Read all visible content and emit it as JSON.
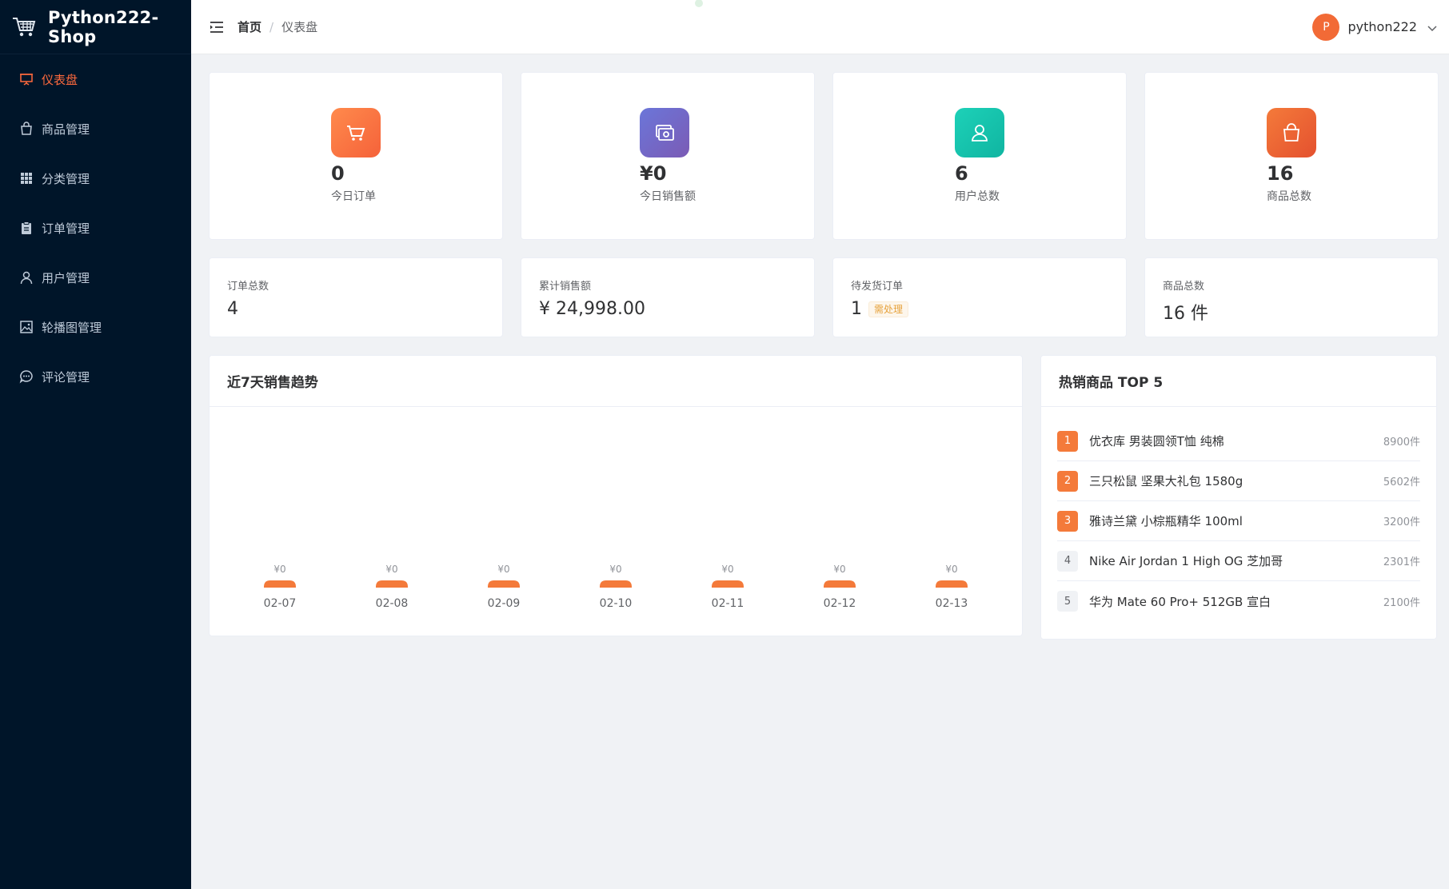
{
  "app": {
    "title": "Python222-Shop"
  },
  "sidebar": {
    "items": [
      {
        "label": "仪表盘",
        "icon": "presentation-icon",
        "active": true
      },
      {
        "label": "商品管理",
        "icon": "bag-icon",
        "active": false
      },
      {
        "label": "分类管理",
        "icon": "grid-icon",
        "active": false
      },
      {
        "label": "订单管理",
        "icon": "clipboard-icon",
        "active": false
      },
      {
        "label": "用户管理",
        "icon": "user-icon",
        "active": false
      },
      {
        "label": "轮播图管理",
        "icon": "picture-icon",
        "active": false
      },
      {
        "label": "评论管理",
        "icon": "chat-icon",
        "active": false
      }
    ]
  },
  "header": {
    "breadcrumb": {
      "home": "首页",
      "separator": "/",
      "current": "仪表盘"
    },
    "user": {
      "avatar_letter": "P",
      "name": "python222"
    }
  },
  "stats": [
    {
      "value": "0",
      "label": "今日订单",
      "icon": "cart-icon",
      "color": "#f5623a"
    },
    {
      "value": "¥0",
      "label": "今日销售额",
      "icon": "money-icon",
      "color": "#6b76d9"
    },
    {
      "value": "6",
      "label": "用户总数",
      "icon": "user-icon",
      "color": "#10b5a1"
    },
    {
      "value": "16",
      "label": "商品总数",
      "icon": "bag-icon",
      "color": "#e4512f"
    }
  ],
  "summary": [
    {
      "label": "订单总数",
      "value": "4"
    },
    {
      "label": "累计销售额",
      "value": "¥ 24,998.00"
    },
    {
      "label": "待发货订单",
      "value": "1",
      "tag": "需处理"
    },
    {
      "label": "商品总数",
      "value": "16 件"
    }
  ],
  "sales_chart": {
    "title": "近7天销售趋势",
    "bar_color": "#f47a3a"
  },
  "chart_data": {
    "type": "bar",
    "title": "近7天销售趋势",
    "categories": [
      "02-07",
      "02-08",
      "02-09",
      "02-10",
      "02-11",
      "02-12",
      "02-13"
    ],
    "values": [
      0,
      0,
      0,
      0,
      0,
      0,
      0
    ],
    "value_labels": [
      "¥0",
      "¥0",
      "¥0",
      "¥0",
      "¥0",
      "¥0",
      "¥0"
    ],
    "xlabel": "",
    "ylabel": ""
  },
  "top_products": {
    "title": "热销商品 TOP 5",
    "items": [
      {
        "rank": "1",
        "name": "优衣库 男装圆领T恤 纯棉",
        "sales": "8900件",
        "hot": true
      },
      {
        "rank": "2",
        "name": "三只松鼠 坚果大礼包 1580g",
        "sales": "5602件",
        "hot": true
      },
      {
        "rank": "3",
        "name": "雅诗兰黛 小棕瓶精华 100ml",
        "sales": "3200件",
        "hot": true
      },
      {
        "rank": "4",
        "name": "Nike Air Jordan 1 High OG 芝加哥",
        "sales": "2301件",
        "hot": false
      },
      {
        "rank": "5",
        "name": "华为 Mate 60 Pro+ 512GB 宣白",
        "sales": "2100件",
        "hot": false
      }
    ]
  }
}
